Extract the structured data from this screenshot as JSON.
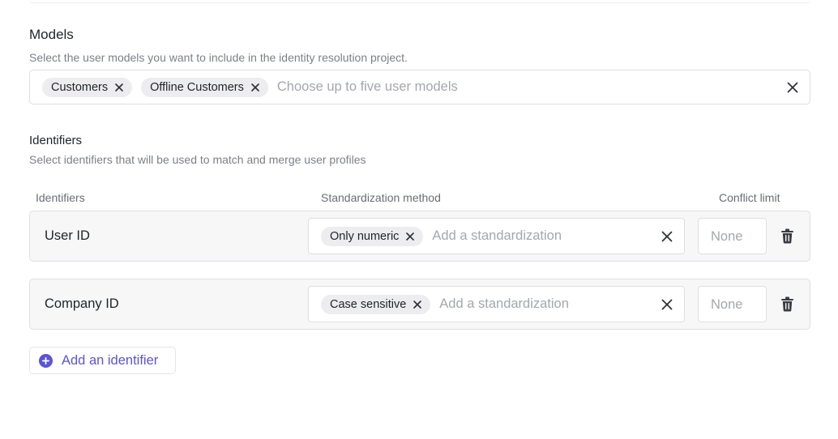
{
  "models": {
    "title": "Models",
    "subtitle": "Select the user models you want to include in the identity resolution project.",
    "chips": [
      "Customers",
      "Offline Customers"
    ],
    "placeholder": "Choose up to five user models"
  },
  "identifiers": {
    "title": "Identifiers",
    "subtitle": "Select identifiers that will be used to match and merge user profiles",
    "columns": {
      "identifier": "Identifiers",
      "method": "Standardization method",
      "limit": "Conflict limit"
    },
    "rows": [
      {
        "name": "User ID",
        "method_chip": "Only numeric",
        "method_placeholder": "Add a standardization",
        "limit_placeholder": "None"
      },
      {
        "name": "Company ID",
        "method_chip": "Case sensitive",
        "method_placeholder": "Add a standardization",
        "limit_placeholder": "None"
      }
    ],
    "add_label": "Add an identifier"
  },
  "icons": {
    "remove_chip": "close-icon",
    "clear": "close-icon",
    "delete_row": "trash-icon",
    "add": "plus-circle-icon"
  },
  "colors": {
    "accent": "#5b54d6",
    "chip_bg": "#ededef",
    "row_bg": "#f7f7f8",
    "border": "#dedfe3"
  }
}
